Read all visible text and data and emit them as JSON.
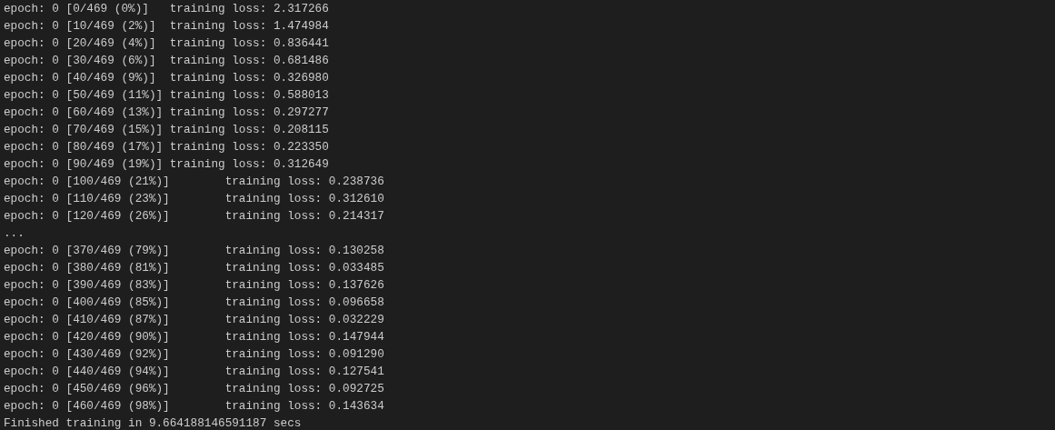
{
  "terminal": {
    "lines": [
      {
        "kind": "progress",
        "progress": "epoch: 0 [0/469 (0%)]",
        "loss": "training loss: 2.317266"
      },
      {
        "kind": "progress",
        "progress": "epoch: 0 [10/469 (2%)]",
        "loss": "training loss: 1.474984"
      },
      {
        "kind": "progress",
        "progress": "epoch: 0 [20/469 (4%)]",
        "loss": "training loss: 0.836441"
      },
      {
        "kind": "progress",
        "progress": "epoch: 0 [30/469 (6%)]",
        "loss": "training loss: 0.681486"
      },
      {
        "kind": "progress",
        "progress": "epoch: 0 [40/469 (9%)]",
        "loss": "training loss: 0.326980"
      },
      {
        "kind": "progress",
        "progress": "epoch: 0 [50/469 (11%)]",
        "loss": "training loss: 0.588013"
      },
      {
        "kind": "progress",
        "progress": "epoch: 0 [60/469 (13%)]",
        "loss": "training loss: 0.297277"
      },
      {
        "kind": "progress",
        "progress": "epoch: 0 [70/469 (15%)]",
        "loss": "training loss: 0.208115"
      },
      {
        "kind": "progress",
        "progress": "epoch: 0 [80/469 (17%)]",
        "loss": "training loss: 0.223350"
      },
      {
        "kind": "progress",
        "progress": "epoch: 0 [90/469 (19%)]",
        "loss": "training loss: 0.312649"
      },
      {
        "kind": "progress",
        "progress": "epoch: 0 [100/469 (21%)]",
        "loss": "training loss: 0.238736"
      },
      {
        "kind": "progress",
        "progress": "epoch: 0 [110/469 (23%)]",
        "loss": "training loss: 0.312610"
      },
      {
        "kind": "progress",
        "progress": "epoch: 0 [120/469 (26%)]",
        "loss": "training loss: 0.214317"
      },
      {
        "kind": "text",
        "text": "..."
      },
      {
        "kind": "progress",
        "progress": "epoch: 0 [370/469 (79%)]",
        "loss": "training loss: 0.130258"
      },
      {
        "kind": "progress",
        "progress": "epoch: 0 [380/469 (81%)]",
        "loss": "training loss: 0.033485"
      },
      {
        "kind": "progress",
        "progress": "epoch: 0 [390/469 (83%)]",
        "loss": "training loss: 0.137626"
      },
      {
        "kind": "progress",
        "progress": "epoch: 0 [400/469 (85%)]",
        "loss": "training loss: 0.096658"
      },
      {
        "kind": "progress",
        "progress": "epoch: 0 [410/469 (87%)]",
        "loss": "training loss: 0.032229"
      },
      {
        "kind": "progress",
        "progress": "epoch: 0 [420/469 (90%)]",
        "loss": "training loss: 0.147944"
      },
      {
        "kind": "progress",
        "progress": "epoch: 0 [430/469 (92%)]",
        "loss": "training loss: 0.091290"
      },
      {
        "kind": "progress",
        "progress": "epoch: 0 [440/469 (94%)]",
        "loss": "training loss: 0.127541"
      },
      {
        "kind": "progress",
        "progress": "epoch: 0 [450/469 (96%)]",
        "loss": "training loss: 0.092725"
      },
      {
        "kind": "progress",
        "progress": "epoch: 0 [460/469 (98%)]",
        "loss": "training loss: 0.143634"
      },
      {
        "kind": "text",
        "text": "Finished training in 9.664188146591187 secs"
      }
    ]
  }
}
